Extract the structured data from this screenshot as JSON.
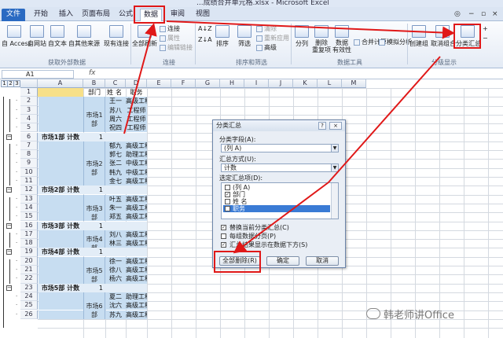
{
  "window": {
    "title": "...成绩合并单元格.xlsx - Microsoft Excel"
  },
  "tabs": [
    "文件",
    "开始",
    "插入",
    "页面布局",
    "公式",
    "数据",
    "审阅",
    "视图"
  ],
  "ribbon": {
    "get_external": [
      "自 Access",
      "自网站",
      "自文本",
      "自其他来源",
      "现有连接"
    ],
    "refresh": "全部刷新",
    "connections": [
      "连接",
      "属性",
      "编辑链接"
    ],
    "sort": [
      "排序"
    ],
    "filter": "筛选",
    "filter_small": [
      "清除",
      "重新应用",
      "高级"
    ],
    "tools": [
      "分列",
      "删除\n重复项",
      "数据\n有效性",
      "合并计算",
      "模拟分析"
    ],
    "outline": [
      "创建组",
      "取消组合",
      "分类汇总"
    ],
    "groups": [
      "获取外部数据",
      "连接",
      "排序和筛选",
      "数据工具",
      "分级显示"
    ]
  },
  "formula_bar": {
    "name_box": "A1",
    "fx": "fx"
  },
  "sheet": {
    "levels": [
      "1",
      "2",
      "3"
    ],
    "columns": [
      "A",
      "B",
      "C",
      "D",
      "E",
      "F",
      "G",
      "H",
      "I",
      "J",
      "K",
      "L",
      "M"
    ],
    "header": {
      "b": "部门",
      "c": "姓名",
      "d": "职务"
    },
    "rows": [
      {
        "n": "1",
        "type": "header"
      },
      {
        "n": "2",
        "name": "王一",
        "title": "高级工程师"
      },
      {
        "n": "3",
        "name": "苏八",
        "title": "工程师"
      },
      {
        "n": "4",
        "name": "周六",
        "title": "工程师"
      },
      {
        "n": "5",
        "name": "祝四",
        "title": "工程师"
      },
      {
        "n": "6",
        "type": "total",
        "label": "市场1部 计数",
        "count": "1"
      },
      {
        "n": "7",
        "name": "郁九",
        "title": "高级工程师"
      },
      {
        "n": "8",
        "name": "郭七",
        "title": "助理工程师"
      },
      {
        "n": "9",
        "name": "张二",
        "title": "中级工程师"
      },
      {
        "n": "10",
        "name": "韩九",
        "title": "中级工程师"
      },
      {
        "n": "11",
        "name": "金七",
        "title": "高级工程师"
      },
      {
        "n": "12",
        "type": "total",
        "label": "市场2部 计数",
        "count": "1"
      },
      {
        "n": "13",
        "name": "叶五",
        "title": "高级工程师"
      },
      {
        "n": "14",
        "name": "朱一",
        "title": "高级工程师"
      },
      {
        "n": "15",
        "name": "郑五",
        "title": "高级工程师"
      },
      {
        "n": "16",
        "type": "total",
        "label": "市场3部 计数",
        "count": "1"
      },
      {
        "n": "17",
        "name": "刘八",
        "title": "高级工程师"
      },
      {
        "n": "18",
        "name": "林三",
        "title": "高级工程师"
      },
      {
        "n": "19",
        "type": "total",
        "label": "市场4部 计数",
        "count": "1"
      },
      {
        "n": "20",
        "name": "徐一",
        "title": "高级工程师"
      },
      {
        "n": "21",
        "name": "徐八",
        "title": "高级工程师"
      },
      {
        "n": "22",
        "name": "杨六",
        "title": "高级工程师"
      },
      {
        "n": "23",
        "type": "total",
        "label": "市场5部 计数",
        "count": "1"
      },
      {
        "n": "24",
        "name": "夏二",
        "title": "助理工程师"
      },
      {
        "n": "25",
        "name": "沈六",
        "title": "高级工程师"
      },
      {
        "n": "26",
        "name": "苏九",
        "title": "高级工程师"
      }
    ],
    "merged_depts": [
      {
        "label": "市场1部",
        "from": 1,
        "to": 4
      },
      {
        "label": "市场2部",
        "from": 6,
        "to": 10
      },
      {
        "label": "市场3部",
        "from": 12,
        "to": 14
      },
      {
        "label": "市场4部",
        "from": 16,
        "to": 17
      },
      {
        "label": "市场5部",
        "from": 19,
        "to": 21
      },
      {
        "label": "市场6部",
        "from": 23,
        "to": 25
      }
    ]
  },
  "dialog": {
    "title": "分类汇总",
    "help": "?",
    "close": "×",
    "field_label": "分类字段(A):",
    "field_value": "(列 A)",
    "method_label": "汇总方式(U):",
    "method_value": "计数",
    "items_label": "选定汇总项(D):",
    "items": [
      {
        "label": "(列 A)",
        "checked": false
      },
      {
        "label": "部门",
        "checked": true
      },
      {
        "label": "姓 名",
        "checked": false
      },
      {
        "label": "职务",
        "checked": false,
        "selected": true
      }
    ],
    "options": [
      {
        "label": "替换当前分类汇总(C)",
        "checked": true
      },
      {
        "label": "每组数据分页(P)",
        "checked": false
      },
      {
        "label": "汇总结果显示在数据下方(S)",
        "checked": true
      }
    ],
    "buttons": {
      "remove_all": "全部删除(R)",
      "ok": "确定",
      "cancel": "取消"
    }
  },
  "watermark": "韩老师讲Office",
  "colors": {
    "accent_red": "#e01818",
    "merged_blue": "#c7ddf1",
    "header_yellow": "#f7e089"
  }
}
